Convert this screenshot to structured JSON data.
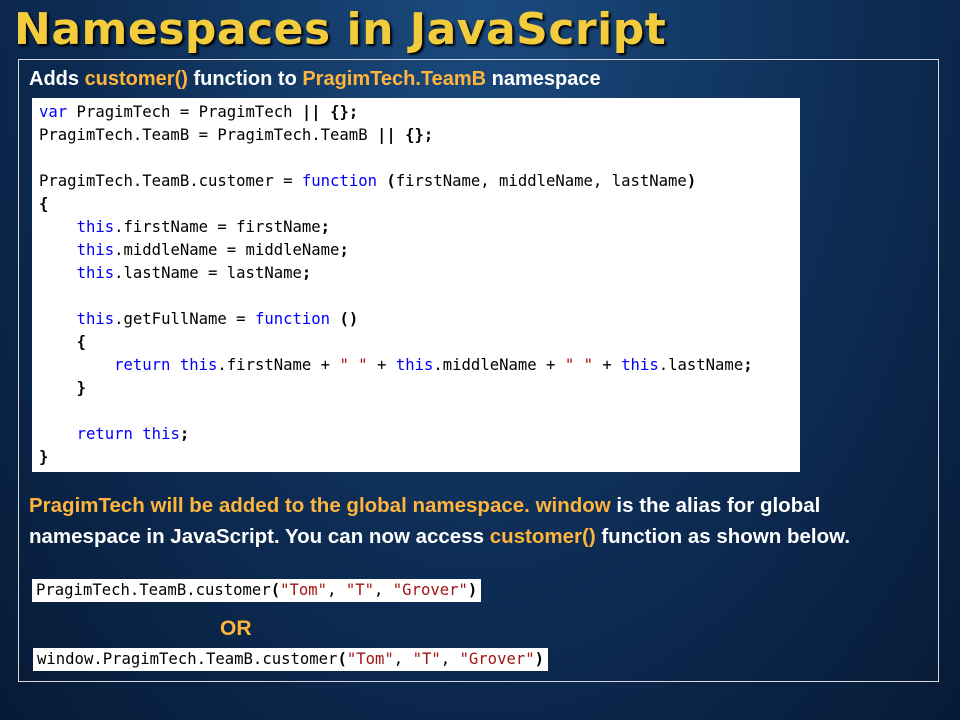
{
  "title": "Namespaces in JavaScript",
  "heading": {
    "part1": "Adds ",
    "hl1": "customer()",
    "part2": " function to ",
    "hl2": "PragimTech.TeamB",
    "part3": " namespace"
  },
  "code": {
    "l1_a": "var",
    "l1_b": " PragimTech = PragimTech ",
    "l1_c": "||",
    "l1_d": " ",
    "l1_e": "{};",
    "l2_a": "PragimTech.TeamB = PragimTech.TeamB ",
    "l2_b": "||",
    "l2_c": " ",
    "l2_d": "{};",
    "l4_a": "PragimTech.TeamB.customer = ",
    "l4_b": "function",
    "l4_c": " ",
    "l4_d": "(",
    "l4_e": "firstName, middleName, lastName",
    "l4_f": ")",
    "l5": "{",
    "l6_a": "this",
    "l6_b": ".firstName = firstName",
    "l6_c": ";",
    "l7_a": "this",
    "l7_b": ".middleName = middleName",
    "l7_c": ";",
    "l8_a": "this",
    "l8_b": ".lastName = lastName",
    "l8_c": ";",
    "l10_a": "this",
    "l10_b": ".getFullName = ",
    "l10_c": "function",
    "l10_d": " ",
    "l10_e": "()",
    "l11": "{",
    "l12_a": "return",
    "l12_b": " ",
    "l12_c": "this",
    "l12_d": ".firstName + ",
    "l12_e": "\" \"",
    "l12_f": " + ",
    "l12_g": "this",
    "l12_h": ".middleName + ",
    "l12_i": "\" \"",
    "l12_j": " + ",
    "l12_k": "this",
    "l12_l": ".lastName",
    "l12_m": ";",
    "l13": "}",
    "l15_a": "return",
    "l15_b": " ",
    "l15_c": "this",
    "l15_d": ";",
    "l16": "}"
  },
  "description": {
    "hl1": "PragimTech will be added to the global namespace.",
    "p1": " ",
    "hl2": "window",
    "p2": " is the alias for global namespace in JavaScript. You can now access ",
    "hl3": "customer()",
    "p3": " function as shown below."
  },
  "snippet1": {
    "a": "PragimTech.TeamB.customer",
    "b": "(",
    "c": "\"Tom\"",
    "d": ", ",
    "e": "\"T\"",
    "f": ", ",
    "g": "\"Grover\"",
    "h": ")"
  },
  "or_label": "OR",
  "snippet2": {
    "a": "window.PragimTech.TeamB.customer",
    "b": "(",
    "c": "\"Tom\"",
    "d": ", ",
    "e": "\"T\"",
    "f": ", ",
    "g": "\"Grover\"",
    "h": ")"
  },
  "colors": {
    "title": "#f2cc3c",
    "highlight": "#ffb43c",
    "keyword": "#0000ff",
    "string": "#a31515"
  }
}
